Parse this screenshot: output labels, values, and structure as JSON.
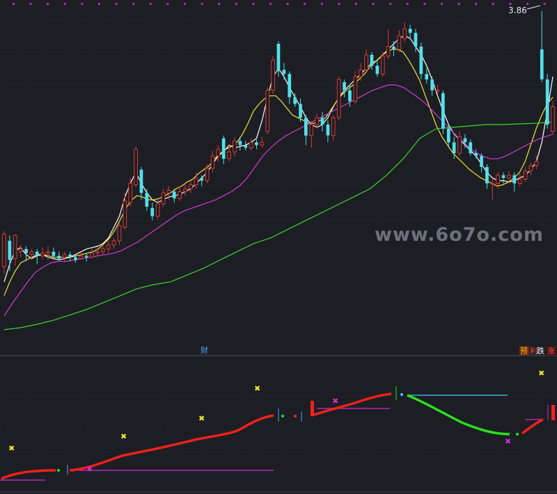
{
  "chart_data": [
    {
      "type": "candlestick",
      "panel": "main",
      "price_max_label": "3.86",
      "watermark": "www.6o7o.com",
      "ylim": [
        1.58,
        3.92
      ],
      "candles": [
        {
          "o": 2.01,
          "c": 2.25,
          "h": 2.27,
          "l": 1.96
        },
        {
          "o": 2.2,
          "c": 2.06,
          "h": 2.24,
          "l": 1.98
        },
        {
          "o": 2.07,
          "c": 2.24,
          "h": 2.25,
          "l": 2.02
        },
        {
          "o": 2.12,
          "c": 2.14,
          "h": 2.17,
          "l": 2.08
        },
        {
          "o": 2.14,
          "c": 2.11,
          "h": 2.16,
          "l": 2.05
        },
        {
          "o": 2.1,
          "c": 2.12,
          "h": 2.14,
          "l": 2.06
        },
        {
          "o": 2.12,
          "c": 2.09,
          "h": 2.14,
          "l": 2.03
        },
        {
          "o": 2.09,
          "c": 2.11,
          "h": 2.15,
          "l": 2.07
        },
        {
          "o": 2.11,
          "c": 2.12,
          "h": 2.16,
          "l": 2.06
        },
        {
          "o": 2.12,
          "c": 2.09,
          "h": 2.15,
          "l": 2.06
        },
        {
          "o": 2.09,
          "c": 2.07,
          "h": 2.12,
          "l": 2.06
        },
        {
          "o": 2.08,
          "c": 2.1,
          "h": 2.12,
          "l": 2.05
        },
        {
          "o": 2.1,
          "c": 2.08,
          "h": 2.12,
          "l": 2.05
        },
        {
          "o": 2.08,
          "c": 2.06,
          "h": 2.1,
          "l": 2.04
        },
        {
          "o": 2.07,
          "c": 2.09,
          "h": 2.12,
          "l": 2.06
        },
        {
          "o": 2.09,
          "c": 2.08,
          "h": 2.11,
          "l": 2.05
        },
        {
          "o": 2.08,
          "c": 2.11,
          "h": 2.14,
          "l": 2.07
        },
        {
          "o": 2.11,
          "c": 2.12,
          "h": 2.15,
          "l": 2.09
        },
        {
          "o": 2.12,
          "c": 2.14,
          "h": 2.17,
          "l": 2.1
        },
        {
          "o": 2.14,
          "c": 2.17,
          "h": 2.2,
          "l": 2.11
        },
        {
          "o": 2.17,
          "c": 2.2,
          "h": 2.22,
          "l": 2.14
        },
        {
          "o": 2.2,
          "c": 2.31,
          "h": 2.33,
          "l": 2.17
        },
        {
          "o": 2.3,
          "c": 2.49,
          "h": 2.55,
          "l": 2.28
        },
        {
          "o": 2.48,
          "c": 2.62,
          "h": 2.66,
          "l": 2.45
        },
        {
          "o": 2.61,
          "c": 2.87,
          "h": 2.89,
          "l": 2.59
        },
        {
          "o": 2.72,
          "c": 2.55,
          "h": 2.74,
          "l": 2.5
        },
        {
          "o": 2.55,
          "c": 2.45,
          "h": 2.58,
          "l": 2.42
        },
        {
          "o": 2.44,
          "c": 2.38,
          "h": 2.48,
          "l": 2.35
        },
        {
          "o": 2.38,
          "c": 2.47,
          "h": 2.5,
          "l": 2.36
        },
        {
          "o": 2.47,
          "c": 2.55,
          "h": 2.58,
          "l": 2.45
        },
        {
          "o": 2.55,
          "c": 2.57,
          "h": 2.6,
          "l": 2.5
        },
        {
          "o": 2.56,
          "c": 2.51,
          "h": 2.58,
          "l": 2.48
        },
        {
          "o": 2.51,
          "c": 2.56,
          "h": 2.6,
          "l": 2.49
        },
        {
          "o": 2.56,
          "c": 2.58,
          "h": 2.62,
          "l": 2.53
        },
        {
          "o": 2.58,
          "c": 2.61,
          "h": 2.64,
          "l": 2.55
        },
        {
          "o": 2.61,
          "c": 2.66,
          "h": 2.7,
          "l": 2.58
        },
        {
          "o": 2.66,
          "c": 2.64,
          "h": 2.68,
          "l": 2.6
        },
        {
          "o": 2.64,
          "c": 2.73,
          "h": 2.76,
          "l": 2.62
        },
        {
          "o": 2.73,
          "c": 2.82,
          "h": 2.86,
          "l": 2.7
        },
        {
          "o": 2.82,
          "c": 2.87,
          "h": 2.9,
          "l": 2.78
        },
        {
          "o": 2.95,
          "c": 2.8,
          "h": 2.97,
          "l": 2.76
        },
        {
          "o": 2.8,
          "c": 2.85,
          "h": 2.9,
          "l": 2.78
        },
        {
          "o": 2.85,
          "c": 2.93,
          "h": 2.96,
          "l": 2.82
        },
        {
          "o": 2.93,
          "c": 2.9,
          "h": 2.96,
          "l": 2.86
        },
        {
          "o": 2.9,
          "c": 2.88,
          "h": 2.93,
          "l": 2.86
        },
        {
          "o": 2.88,
          "c": 2.92,
          "h": 2.95,
          "l": 2.86
        },
        {
          "o": 2.92,
          "c": 2.9,
          "h": 2.94,
          "l": 2.87
        },
        {
          "o": 2.9,
          "c": 2.92,
          "h": 2.96,
          "l": 2.88
        },
        {
          "o": 3.0,
          "c": 3.3,
          "h": 3.32,
          "l": 2.98
        },
        {
          "o": 3.3,
          "c": 3.52,
          "h": 3.55,
          "l": 3.27
        },
        {
          "o": 3.64,
          "c": 3.44,
          "h": 3.66,
          "l": 3.4
        },
        {
          "o": 3.45,
          "c": 3.42,
          "h": 3.5,
          "l": 3.38
        },
        {
          "o": 3.42,
          "c": 3.25,
          "h": 3.44,
          "l": 3.2
        },
        {
          "o": 3.25,
          "c": 3.2,
          "h": 3.28,
          "l": 3.18
        },
        {
          "o": 3.2,
          "c": 3.1,
          "h": 3.24,
          "l": 3.07
        },
        {
          "o": 3.1,
          "c": 2.97,
          "h": 3.12,
          "l": 2.9
        },
        {
          "o": 2.97,
          "c": 3.05,
          "h": 3.08,
          "l": 2.88
        },
        {
          "o": 3.05,
          "c": 3.1,
          "h": 3.13,
          "l": 3.02
        },
        {
          "o": 3.1,
          "c": 3.05,
          "h": 3.14,
          "l": 3.0
        },
        {
          "o": 3.05,
          "c": 2.97,
          "h": 3.08,
          "l": 2.92
        },
        {
          "o": 2.97,
          "c": 3.1,
          "h": 3.12,
          "l": 2.93
        },
        {
          "o": 3.1,
          "c": 3.38,
          "h": 3.4,
          "l": 3.08
        },
        {
          "o": 3.36,
          "c": 3.3,
          "h": 3.38,
          "l": 3.25
        },
        {
          "o": 3.3,
          "c": 3.22,
          "h": 3.34,
          "l": 3.18
        },
        {
          "o": 3.22,
          "c": 3.4,
          "h": 3.44,
          "l": 3.2
        },
        {
          "o": 3.4,
          "c": 3.45,
          "h": 3.5,
          "l": 3.37
        },
        {
          "o": 3.45,
          "c": 3.56,
          "h": 3.6,
          "l": 3.43
        },
        {
          "o": 3.56,
          "c": 3.48,
          "h": 3.58,
          "l": 3.45
        },
        {
          "o": 3.48,
          "c": 3.42,
          "h": 3.52,
          "l": 3.4
        },
        {
          "o": 3.42,
          "c": 3.55,
          "h": 3.58,
          "l": 3.4
        },
        {
          "o": 3.55,
          "c": 3.62,
          "h": 3.75,
          "l": 3.53
        },
        {
          "o": 3.62,
          "c": 3.6,
          "h": 3.66,
          "l": 3.55
        },
        {
          "o": 3.6,
          "c": 3.7,
          "h": 3.74,
          "l": 3.58
        },
        {
          "o": 3.68,
          "c": 3.75,
          "h": 3.8,
          "l": 3.65
        },
        {
          "o": 3.75,
          "c": 3.72,
          "h": 3.78,
          "l": 3.68
        },
        {
          "o": 3.72,
          "c": 3.62,
          "h": 3.75,
          "l": 3.58
        },
        {
          "o": 3.62,
          "c": 3.42,
          "h": 3.65,
          "l": 3.38
        },
        {
          "o": 3.42,
          "c": 3.38,
          "h": 3.46,
          "l": 3.35
        },
        {
          "o": 3.38,
          "c": 3.3,
          "h": 3.4,
          "l": 3.26
        },
        {
          "o": 3.3,
          "c": 3.3,
          "h": 3.34,
          "l": 3.27
        },
        {
          "o": 3.28,
          "c": 3.02,
          "h": 3.3,
          "l": 2.98
        },
        {
          "o": 3.02,
          "c": 2.92,
          "h": 3.05,
          "l": 2.88
        },
        {
          "o": 2.92,
          "c": 2.84,
          "h": 2.96,
          "l": 2.8
        },
        {
          "o": 2.84,
          "c": 2.96,
          "h": 3.0,
          "l": 2.82
        },
        {
          "o": 2.95,
          "c": 2.92,
          "h": 2.98,
          "l": 2.88
        },
        {
          "o": 2.92,
          "c": 2.84,
          "h": 2.94,
          "l": 2.82
        },
        {
          "o": 2.84,
          "c": 2.82,
          "h": 2.87,
          "l": 2.8
        },
        {
          "o": 2.82,
          "c": 2.74,
          "h": 2.84,
          "l": 2.7
        },
        {
          "o": 2.74,
          "c": 2.62,
          "h": 2.76,
          "l": 2.58
        },
        {
          "o": 2.62,
          "c": 2.62,
          "h": 2.66,
          "l": 2.5
        },
        {
          "o": 2.62,
          "c": 2.68,
          "h": 2.7,
          "l": 2.58
        },
        {
          "o": 2.68,
          "c": 2.66,
          "h": 2.7,
          "l": 2.62
        },
        {
          "o": 2.66,
          "c": 2.68,
          "h": 2.71,
          "l": 2.62
        },
        {
          "o": 2.68,
          "c": 2.62,
          "h": 2.7,
          "l": 2.56
        },
        {
          "o": 2.62,
          "c": 2.65,
          "h": 2.69,
          "l": 2.6
        },
        {
          "o": 2.65,
          "c": 2.71,
          "h": 2.74,
          "l": 2.63
        },
        {
          "o": 2.71,
          "c": 2.75,
          "h": 2.77,
          "l": 2.68
        },
        {
          "o": 2.75,
          "c": 2.78,
          "h": 2.82,
          "l": 2.72
        },
        {
          "o": 3.6,
          "c": 3.38,
          "h": 3.88,
          "l": 3.36
        },
        {
          "o": 3.38,
          "c": 3.05,
          "h": 3.42,
          "l": 3.02
        },
        {
          "o": 3.0,
          "c": 3.18,
          "h": 3.22,
          "l": 2.98
        }
      ],
      "ma_lines": [
        {
          "name": "MA5",
          "color": "#ffffff",
          "values": [
            1.9,
            2.03,
            2.13,
            2.15,
            2.1,
            2.07,
            2.09,
            2.1,
            2.08,
            2.07,
            2.06,
            2.07,
            2.08,
            2.1,
            2.12,
            2.14,
            2.15,
            2.16,
            2.18,
            2.22,
            2.3,
            2.38,
            2.52,
            2.62,
            2.7,
            2.62,
            2.55,
            2.5,
            2.48,
            2.5,
            2.52,
            2.53,
            2.54,
            2.56,
            2.58,
            2.62,
            2.66,
            2.7,
            2.76,
            2.82,
            2.85,
            2.9,
            2.88,
            2.89,
            2.9,
            2.92,
            2.95,
            3.08,
            3.25,
            3.4,
            3.46,
            3.4,
            3.32,
            3.25,
            3.18,
            3.1,
            3.05,
            3.03,
            3.05,
            3.1,
            3.18,
            3.25,
            3.3,
            3.34,
            3.38,
            3.42,
            3.46,
            3.5,
            3.52,
            3.56,
            3.6,
            3.64,
            3.68,
            3.7,
            3.68,
            3.62,
            3.56,
            3.48,
            3.38,
            3.26,
            3.15,
            3.05,
            2.98,
            2.94,
            2.9,
            2.86,
            2.82,
            2.76,
            2.7,
            2.66,
            2.64,
            2.64,
            2.63,
            2.64,
            2.66,
            2.68,
            2.72,
            2.78,
            2.92,
            3.15,
            3.4
          ]
        },
        {
          "name": "MA10",
          "color": "#f0e53a",
          "values": [
            1.8,
            1.9,
            1.98,
            2.04,
            2.06,
            2.08,
            2.1,
            2.1,
            2.09,
            2.08,
            2.08,
            2.08,
            2.08,
            2.09,
            2.1,
            2.11,
            2.12,
            2.14,
            2.18,
            2.22,
            2.28,
            2.36,
            2.44,
            2.5,
            2.53,
            2.52,
            2.5,
            2.5,
            2.51,
            2.53,
            2.55,
            2.58,
            2.6,
            2.63,
            2.65,
            2.69,
            2.72,
            2.75,
            2.8,
            2.84,
            2.87,
            2.89,
            2.92,
            2.98,
            3.06,
            3.15,
            3.2,
            3.24,
            3.26,
            3.26,
            3.22,
            3.17,
            3.12,
            3.1,
            3.08,
            3.06,
            3.06,
            3.08,
            3.1,
            3.16,
            3.22,
            3.27,
            3.31,
            3.34,
            3.38,
            3.42,
            3.47,
            3.51,
            3.55,
            3.58,
            3.6,
            3.6,
            3.58,
            3.52,
            3.45,
            3.37,
            3.26,
            3.15,
            3.04,
            2.96,
            2.9,
            2.84,
            2.8,
            2.76,
            2.72,
            2.69,
            2.66,
            2.64,
            2.62,
            2.6,
            2.61,
            2.63,
            2.66,
            2.7,
            2.78,
            2.9,
            3.02,
            3.12,
            3.2,
            3.25
          ]
        },
        {
          "name": "MA20",
          "color": "#d23bd6",
          "values": [
            1.65,
            1.74,
            1.82,
            1.9,
            1.97,
            2.01,
            2.04,
            2.05,
            2.05,
            2.06,
            2.07,
            2.08,
            2.09,
            2.1,
            2.11,
            2.13,
            2.16,
            2.19,
            2.23,
            2.27,
            2.31,
            2.35,
            2.39,
            2.42,
            2.44,
            2.46,
            2.48,
            2.5,
            2.53,
            2.56,
            2.6,
            2.66,
            2.74,
            2.82,
            2.88,
            2.93,
            2.97,
            3.0,
            3.03,
            3.06,
            3.09,
            3.12,
            3.15,
            3.18,
            3.21,
            3.24,
            3.27,
            3.3,
            3.32,
            3.34,
            3.34,
            3.32,
            3.28,
            3.24,
            3.19,
            3.13,
            3.07,
            3.01,
            2.95,
            2.9,
            2.85,
            2.82,
            2.8,
            2.8,
            2.82,
            2.85,
            2.88,
            2.91,
            2.94,
            2.96,
            2.98
          ]
        },
        {
          "name": "MA60",
          "color": "#3bd62a",
          "values": [
            1.55,
            1.565,
            1.59,
            1.62,
            1.66,
            1.7,
            1.75,
            1.8,
            1.85,
            1.88,
            1.9,
            1.95,
            2.0,
            2.06,
            2.12,
            2.18,
            2.22,
            2.28,
            2.34,
            2.4,
            2.46,
            2.52,
            2.58,
            2.68,
            2.8,
            2.95,
            3.02,
            3.03,
            3.04,
            3.05,
            3.05,
            3.055,
            3.06,
            3.07
          ]
        }
      ]
    },
    {
      "type": "indicator",
      "panel": "sub",
      "labels": {
        "center": "财",
        "right_1": "预",
        "right_2": "利",
        "right_3": "跌",
        "right_4": "涨"
      }
    }
  ],
  "colors": {
    "background": "#1c1e24",
    "up": "#d93a34",
    "down": "#52e0ea",
    "indicator_up": "#f0211b",
    "indicator_down": "#2bdf1c",
    "marker_yellow": "#f3e52b",
    "marker_magenta": "#d52bd8",
    "watermark": "#aeb6c8"
  }
}
